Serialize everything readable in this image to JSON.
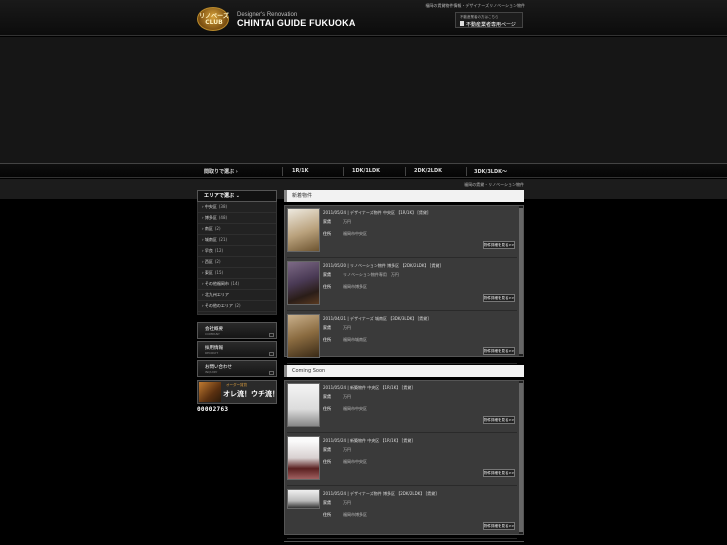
{
  "header": {
    "logo_text": "リノベーズ CLUB",
    "subtitle": "Designer's Renovation",
    "title": "CHINTAI GUIDE FUKUOKA",
    "top_note": "福岡の賃貸物件情報・デザイナーズリノベーション物件",
    "agent_small": "不動産業者の方はこちら",
    "agent_label": "不動産業者専用ページ"
  },
  "nav": {
    "items": [
      "間取りで選ぶ",
      "1R/1K",
      "1DK/1LDK",
      "2DK/2LDK",
      "3DK/3LDK～"
    ]
  },
  "breadcrumb": "福岡の賃貸・リノベーション物件",
  "sidebar": {
    "area_heading": "エリアで選ぶ",
    "areas": [
      {
        "name": "中央区",
        "count": "(38)"
      },
      {
        "name": "博多区",
        "count": "(48)"
      },
      {
        "name": "南区",
        "count": "(2)"
      },
      {
        "name": "城南区",
        "count": "(21)"
      },
      {
        "name": "早良",
        "count": "(12)"
      },
      {
        "name": "西区",
        "count": "(2)"
      },
      {
        "name": "東区",
        "count": "(15)"
      },
      {
        "name": "その他福岡市",
        "count": "(14)"
      },
      {
        "name": "北九州エリア",
        "count": ""
      },
      {
        "name": "その他のエリア",
        "count": "(2)"
      }
    ],
    "buttons": [
      {
        "label": "会社概要",
        "sub": "COMPANY"
      },
      {
        "label": "採用情報",
        "sub": "RECRUIT"
      },
      {
        "label": "お問い合わせ",
        "sub": "INQUIRY"
      }
    ],
    "order_banner": {
      "small": "オーダー賃貸",
      "big": "オレ流！ウチ流！"
    },
    "counter": "00002763"
  },
  "sections": [
    {
      "heading": "新着物件",
      "listings": [
        {
          "date": "2011/05/24",
          "name": "デザイナーズ物件",
          "area": "中央区",
          "layout": "【1R/1K】",
          "tag": "[賃貸]",
          "label1": "家賃",
          "value1": "万円",
          "label2": "住所",
          "value2": "福岡市中央区",
          "more": "物件詳細を見る>>",
          "img": "img-a"
        },
        {
          "date": "2011/05/20",
          "name": "リノベーション物件",
          "area": "博多区",
          "layout": "【2DK/2LDK】",
          "tag": "[賃貸]",
          "label1": "家賃",
          "value1": "リノベーション物件専用　万円",
          "label2": "住所",
          "value2": "福岡市博多区",
          "more": "物件詳細を見る>>",
          "img": "img-b"
        },
        {
          "date": "2011/04/21",
          "name": "デザイナーズ",
          "area": "城南区",
          "layout": "【3DK/3LDK】",
          "tag": "[賃貸]",
          "label1": "家賃",
          "value1": "万円",
          "label2": "住所",
          "value2": "福岡市城南区",
          "more": "物件詳細を見る>>",
          "img": "img-c"
        }
      ]
    },
    {
      "heading": "Coming Soon",
      "listings": [
        {
          "date": "2011/05/24",
          "name": "新築物件",
          "area": "中央区",
          "layout": "【1R/1K】",
          "tag": "[賃貸]",
          "label1": "家賃",
          "value1": "万円",
          "label2": "住所",
          "value2": "福岡市中央区",
          "more": "物件詳細を見る>>",
          "img": "img-d"
        },
        {
          "date": "2011/05/24",
          "name": "新築物件",
          "area": "中央区",
          "layout": "【1R/1K】",
          "tag": "[賃貸]",
          "label1": "家賃",
          "value1": "万円",
          "label2": "住所",
          "value2": "福岡市中央区",
          "more": "物件詳細を見る>>",
          "img": "img-e"
        },
        {
          "date": "2011/05/24",
          "name": "デザイナーズ物件",
          "area": "博多区",
          "layout": "【2DK/2LDK】",
          "tag": "[賃貸]",
          "label1": "家賃",
          "value1": "万円",
          "label2": "住所",
          "value2": "福岡市博多区",
          "more": "物件詳細を見る>>",
          "img": "img-f"
        }
      ]
    }
  ]
}
